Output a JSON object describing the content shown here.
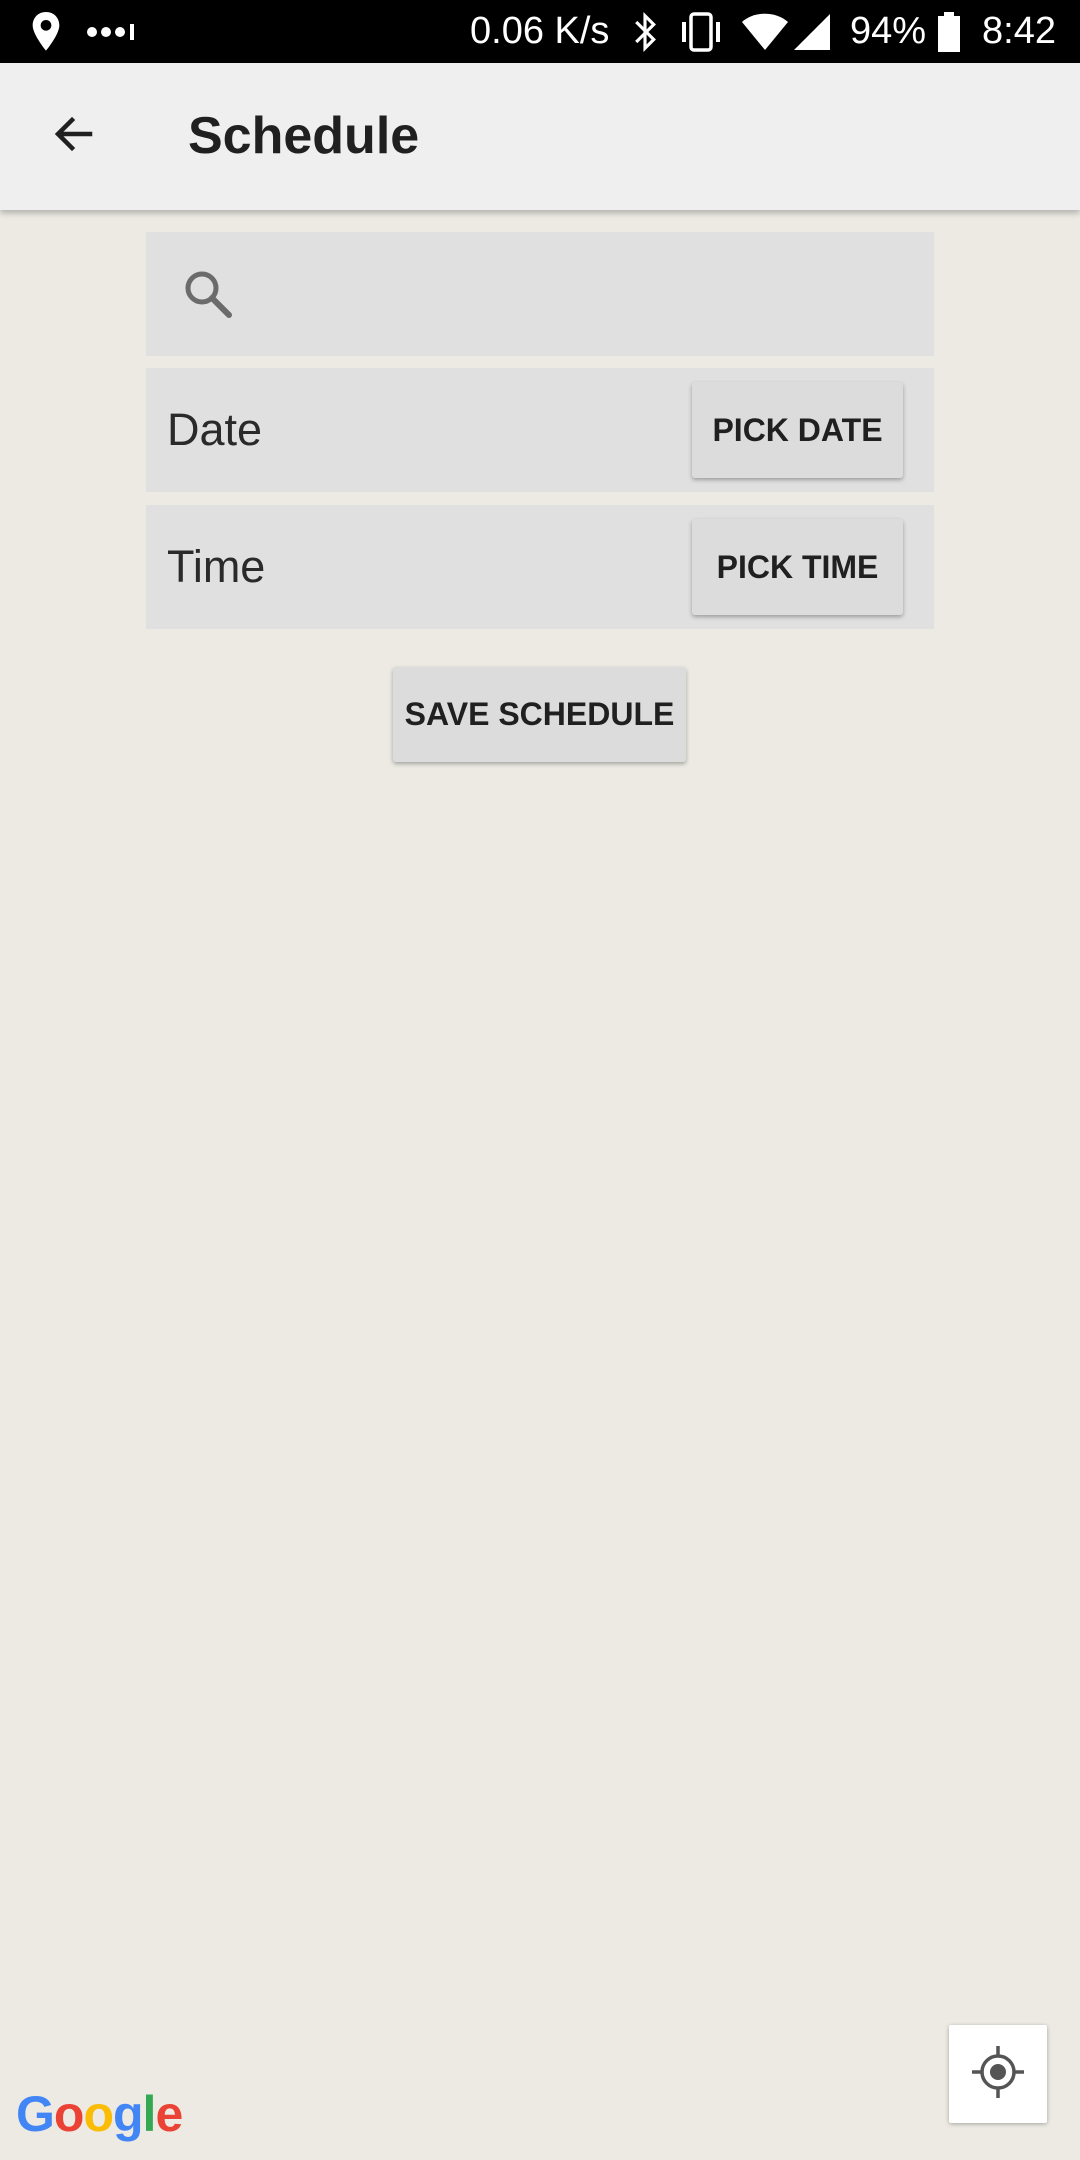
{
  "status_bar": {
    "speed": "0.06 K/s",
    "battery": "94%",
    "time": "8:42",
    "icons": [
      "location-pin-icon",
      "more-dots-icon",
      "bluetooth-icon",
      "vibrate-icon",
      "wifi-icon",
      "signal-icon",
      "battery-icon"
    ]
  },
  "app_bar": {
    "title": "Schedule",
    "back_icon": "back-arrow-icon"
  },
  "search": {
    "icon": "search-icon",
    "value": "",
    "placeholder": ""
  },
  "date_row": {
    "label": "Date",
    "button_label": "PICK DATE"
  },
  "time_row": {
    "label": "Time",
    "button_label": "PICK TIME"
  },
  "save_button_label": "SAVE SCHEDULE",
  "map": {
    "logo_text": "Google",
    "logo_colors": [
      "#4285F4",
      "#EA4335",
      "#FBBC05",
      "#4285F4",
      "#34A853",
      "#EA4335"
    ],
    "my_location_icon": "my-location-icon"
  },
  "colors": {
    "background": "#eceae3",
    "app_bar": "#efefef",
    "panel": "#e0e0e0",
    "button": "#dcdcdc"
  }
}
